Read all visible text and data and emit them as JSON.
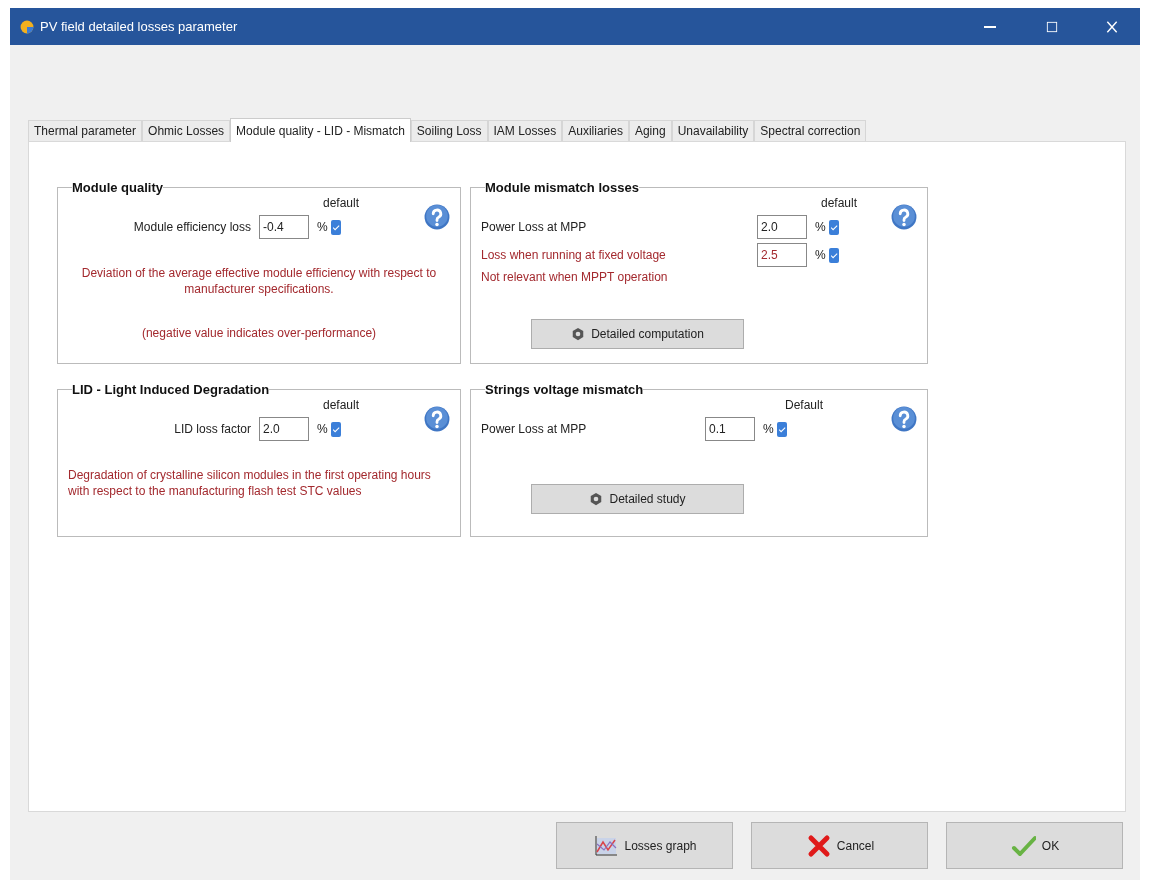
{
  "window": {
    "title": "PV field detailed losses parameter"
  },
  "tabs": [
    {
      "label": "Thermal parameter",
      "selected": false
    },
    {
      "label": "Ohmic Losses",
      "selected": false
    },
    {
      "label": "Module quality - LID - Mismatch",
      "selected": true
    },
    {
      "label": "Soiling Loss",
      "selected": false
    },
    {
      "label": "IAM Losses",
      "selected": false
    },
    {
      "label": "Auxiliaries",
      "selected": false
    },
    {
      "label": "Aging",
      "selected": false
    },
    {
      "label": "Unavailability",
      "selected": false
    },
    {
      "label": "Spectral correction",
      "selected": false
    }
  ],
  "groups": [
    {
      "title": "Module quality",
      "default_label": "default",
      "rows": [
        {
          "label": "Module efficiency loss",
          "value": "-0.4",
          "unit": "%",
          "checked": true,
          "warning": false
        }
      ],
      "notes": [
        "Deviation of the average effective module efficiency with respect to manufacturer specifications.",
        "(negative value indicates over-performance)"
      ]
    },
    {
      "title": "Module mismatch losses",
      "default_label": "default",
      "rows": [
        {
          "label": "Power Loss at MPP",
          "value": "2.0",
          "unit": "%",
          "checked": true,
          "warning": false
        },
        {
          "label": "Loss when running at fixed voltage",
          "value": "2.5",
          "unit": "%",
          "checked": true,
          "warning": true
        }
      ],
      "notes": [
        "Not relevant when MPPT operation"
      ],
      "button": "Detailed computation"
    },
    {
      "title": "LID - Light Induced Degradation",
      "default_label": "default",
      "rows": [
        {
          "label": "LID loss factor",
          "value": "2.0",
          "unit": "%",
          "checked": true,
          "warning": false
        }
      ],
      "notes": [
        "Degradation of crystalline silicon modules in the first operating hours with respect to the manufacturing flash test STC values"
      ]
    },
    {
      "title": "Strings voltage mismatch",
      "default_label": "Default",
      "rows": [
        {
          "label": "Power Loss at MPP",
          "value": "0.1",
          "unit": "%",
          "checked": true,
          "warning": false
        }
      ],
      "button": "Detailed study"
    }
  ],
  "buttons": [
    {
      "kind": "graph",
      "label": "Losses graph"
    },
    {
      "kind": "cancel",
      "label": "Cancel"
    },
    {
      "kind": "ok",
      "label": "OK"
    }
  ]
}
